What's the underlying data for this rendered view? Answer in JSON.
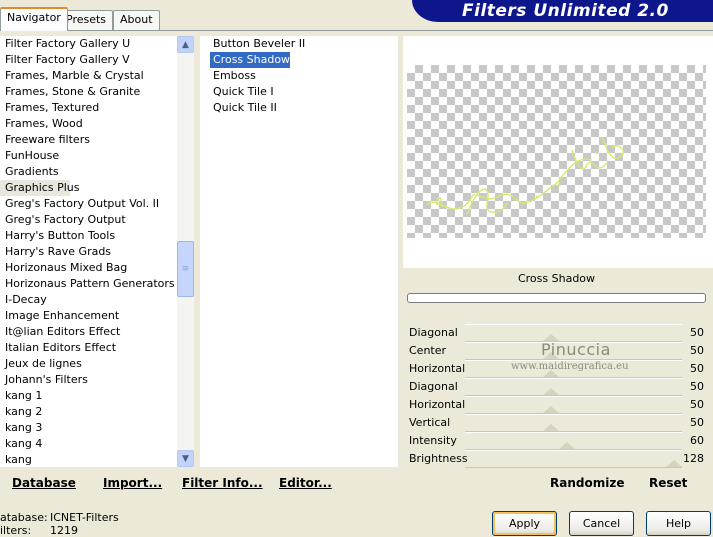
{
  "tabs": [
    "Navigator",
    "Presets",
    "About"
  ],
  "app_title": "Filters Unlimited 2.0",
  "categories": [
    "Filter Factory Gallery U",
    "Filter Factory Gallery V",
    "Frames, Marble & Crystal",
    "Frames, Stone & Granite",
    "Frames, Textured",
    "Frames, Wood",
    "Freeware filters",
    "FunHouse",
    "Gradients",
    "Graphics Plus",
    "Greg's Factory Output Vol. II",
    "Greg's Factory Output",
    "Harry's Button Tools",
    "Harry's Rave Grads",
    "Horizonaus Mixed Bag",
    "Horizonaus Pattern Generators",
    "I-Decay",
    "Image Enhancement",
    "It@lian Editors Effect",
    "Italian Editors Effect",
    "Jeux de lignes",
    "Johann's Filters",
    "kang 1",
    "kang 2",
    "kang 3",
    "kang 4",
    "kang"
  ],
  "selected_category_index": 9,
  "filters": [
    "Button Beveler II",
    "Cross Shadow",
    "Emboss",
    "Quick Tile I",
    "Quick Tile II"
  ],
  "selected_filter_index": 1,
  "filter_title": "Cross Shadow",
  "params": [
    {
      "label": "Diagonal",
      "value": "50",
      "level": 0.39
    },
    {
      "label": "Center",
      "value": "50",
      "level": 0.39
    },
    {
      "label": "Horizontal",
      "value": "50",
      "level": 0.39
    },
    {
      "label": "Diagonal",
      "value": "50",
      "level": 0.39
    },
    {
      "label": "Horizontal",
      "value": "50",
      "level": 0.39
    },
    {
      "label": "Vertical",
      "value": "50",
      "level": 0.39
    },
    {
      "label": "Intensity",
      "value": "60",
      "level": 0.47
    },
    {
      "label": "Brightness",
      "value": "128",
      "level": 1.0
    }
  ],
  "watermark": {
    "name": "Pinuccia",
    "url": "www.maidiregrafica.eu"
  },
  "bottom_links": {
    "database": "Database",
    "import": "Import...",
    "filter_info": "Filter Info...",
    "editor": "Editor...",
    "randomize": "Randomize",
    "reset": "Reset"
  },
  "status": {
    "database_label": "atabase:",
    "database_value": "ICNET-Filters",
    "filters_label": "ilters:",
    "filters_value": "1219"
  },
  "buttons": {
    "apply": "Apply",
    "cancel": "Cancel",
    "help": "Help"
  },
  "colors": {
    "banner": "#0e168c",
    "selection": "#316ac5",
    "preview_art": "#d8e86a"
  }
}
